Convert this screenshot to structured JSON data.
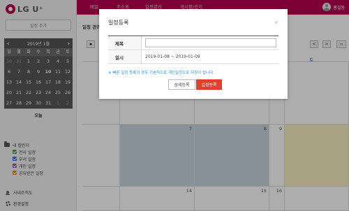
{
  "brand": {
    "logo_text": "LG U⁺"
  },
  "sidebar": {
    "add_schedule_label": "일정 추가",
    "mini_calendar": {
      "month_label": "2019년 1월",
      "prev_icon": "chevron-left-icon",
      "next_icon": "chevron-right-icon",
      "days_of_week": [
        "일",
        "월",
        "화",
        "수",
        "목",
        "금",
        "토"
      ],
      "weeks": [
        [
          "30",
          "31",
          "1",
          "2",
          "3",
          "4",
          "5"
        ],
        [
          "6",
          "7",
          "8",
          "9",
          "10",
          "11",
          "12"
        ],
        [
          "13",
          "14",
          "15",
          "16",
          "17",
          "18",
          "19"
        ],
        [
          "20",
          "21",
          "22",
          "23",
          "24",
          "25",
          "26"
        ],
        [
          "27",
          "28",
          "29",
          "30",
          "31",
          "1",
          "2"
        ]
      ],
      "today_label": "오늘"
    },
    "my_calendar": {
      "title": "내 캘린더",
      "items": [
        {
          "label": "전사 일정",
          "color": "#3aa04a"
        },
        {
          "label": "부서 일정",
          "color": "#2f6fd6"
        },
        {
          "label": "개인 일정",
          "color": "#9b4fc0"
        },
        {
          "label": "공유받은 일정",
          "color": "#e08a1e"
        }
      ]
    },
    "links": {
      "org_chart": "사내조직도",
      "settings": "환경설정"
    }
  },
  "topbar": {
    "nav": [
      "메일",
      "주소록",
      "일정관리",
      "게시판/공지"
    ],
    "user_name": "홍길동"
  },
  "main": {
    "title": "일정 관리",
    "view_buttons": {
      "prev": "<",
      "next": ">"
    },
    "day_label": "토",
    "dates_row2": [
      "7",
      "8",
      "9"
    ],
    "dates_row3": [
      "14",
      "15",
      "16"
    ],
    "colors": {
      "highlight": "#c8d6df",
      "today": "#f8efc2"
    }
  },
  "dialog": {
    "title": "일정등록",
    "close_icon": "close-icon",
    "fields": {
      "subject_label": "제목",
      "subject_value": "",
      "date_label": "일시",
      "date_value": "2019-01-08 ~ 2019-01-09"
    },
    "notice": "※ 빠른 일정 등록의 경우 기본적으로 개인일정으로 저장이 됩니다.",
    "buttons": {
      "detail": "상세등록",
      "register": "일정등록"
    },
    "colors": {
      "primary": "#e0402f",
      "notice": "#2a8bd6"
    }
  }
}
